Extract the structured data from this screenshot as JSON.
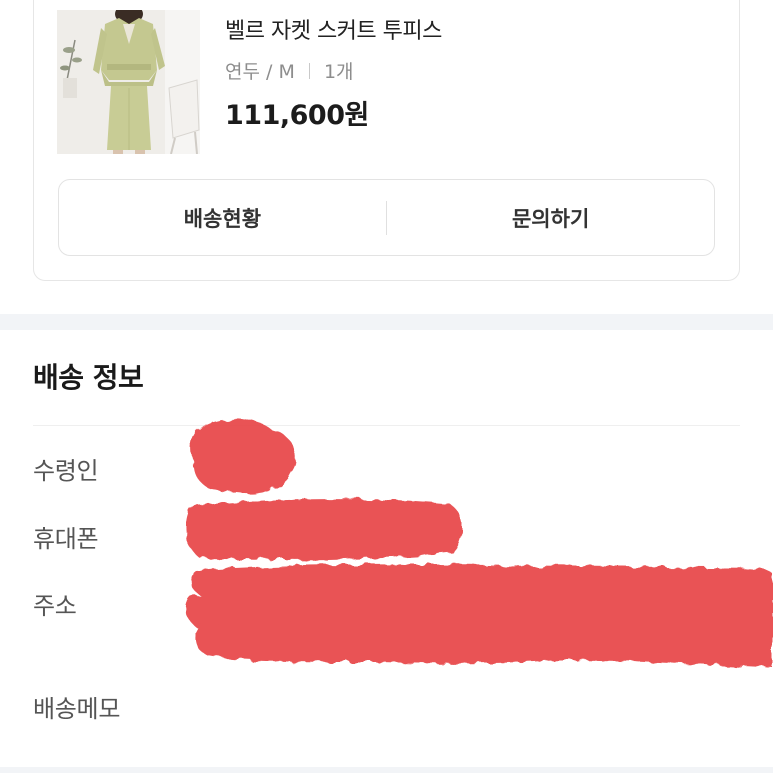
{
  "product": {
    "name": "벨르 자켓 스커트 투피스",
    "color": "연두",
    "size": "M",
    "quantity": "1개",
    "price": "111,600원",
    "image_icon": "product-photo"
  },
  "actions": {
    "shipping_status": "배송현황",
    "inquiry": "문의하기"
  },
  "shipping_info": {
    "title": "배송 정보",
    "labels": {
      "recipient": "수령인",
      "phone": "휴대폰",
      "address": "주소",
      "memo": "배송메모"
    }
  },
  "colors": {
    "redaction": "#e8474a",
    "product_garment": "#c8cc95",
    "section_gap": "#f2f4f7"
  }
}
